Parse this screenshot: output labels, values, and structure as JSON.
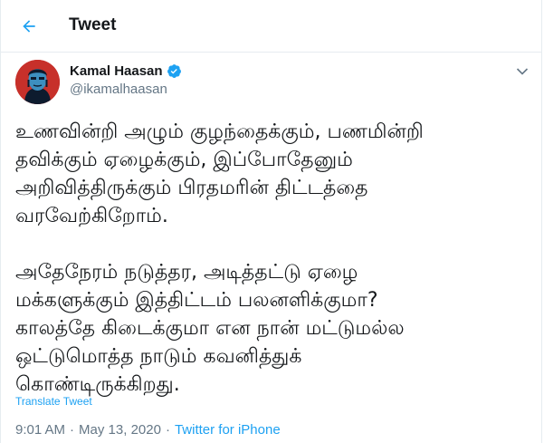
{
  "header": {
    "title": "Tweet",
    "back_icon": "arrow-left-icon",
    "accent": "#1da1f2"
  },
  "tweet": {
    "author": {
      "name": "Kamal Haasan",
      "handle": "@ikamalhaasan",
      "verified": true,
      "verified_icon": "verified-badge-icon"
    },
    "more_icon": "chevron-down-icon",
    "paragraphs": [
      "உணவின்றி அழும் குழந்தைக்கும், பணமின்றி\nதவிக்கும் ஏழைக்கும், இப்போதேனும்\nஅறிவித்திருக்கும் பிரதமரின் திட்டத்தை\nவரவேற்கிறோம்.",
      "அதேநேரம் நடுத்தர, அடித்தட்டு ஏழை\nமக்களுக்கும் இத்திட்டம் பலனளிக்குமா?\nகாலத்தே கிடைக்குமா என நான் மட்டுமல்ல\nஒட்டுமொத்த நாடும் கவனித்துக்\nகொண்டிருக்கிறது."
    ],
    "translate_label": "Translate Tweet",
    "time": "9:01 AM",
    "separator": "·",
    "date": "May 13, 2020",
    "source": "Twitter for iPhone"
  }
}
